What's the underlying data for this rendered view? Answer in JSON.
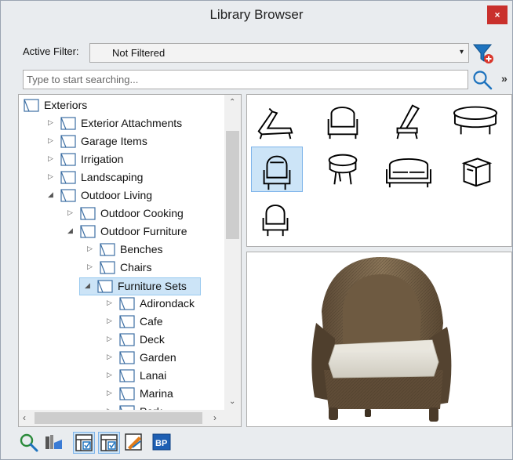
{
  "window": {
    "title": "Library Browser",
    "close_label": "×"
  },
  "filter": {
    "label": "Active Filter:",
    "value": "Not Filtered",
    "arrow": "▾"
  },
  "search": {
    "placeholder": "Type to start searching...",
    "more_label": "»"
  },
  "tree": {
    "items": [
      {
        "label": "Exteriors",
        "level": 0,
        "expander": ""
      },
      {
        "label": "Exterior Attachments",
        "level": 1,
        "expander": "▷"
      },
      {
        "label": "Garage Items",
        "level": 1,
        "expander": "▷"
      },
      {
        "label": "Irrigation",
        "level": 1,
        "expander": "▷"
      },
      {
        "label": "Landscaping",
        "level": 1,
        "expander": "▷"
      },
      {
        "label": "Outdoor Living",
        "level": 1,
        "expander": "◢"
      },
      {
        "label": "Outdoor Cooking",
        "level": 2,
        "expander": "▷"
      },
      {
        "label": "Outdoor Furniture",
        "level": 2,
        "expander": "◢"
      },
      {
        "label": "Benches",
        "level": 3,
        "expander": "▷"
      },
      {
        "label": "Chairs",
        "level": 3,
        "expander": "▷"
      },
      {
        "label": "Furniture Sets",
        "level": 3,
        "expander": "◢",
        "selected": true
      },
      {
        "label": "Adirondack",
        "level": 4,
        "expander": "▷"
      },
      {
        "label": "Cafe",
        "level": 4,
        "expander": "▷"
      },
      {
        "label": "Deck",
        "level": 4,
        "expander": "▷"
      },
      {
        "label": "Garden",
        "level": 4,
        "expander": "▷"
      },
      {
        "label": "Lanai",
        "level": 4,
        "expander": "▷"
      },
      {
        "label": "Marina",
        "level": 4,
        "expander": "▷"
      },
      {
        "label": "Park",
        "level": 4,
        "expander": "▷"
      }
    ]
  },
  "thumbnails": [
    {
      "icon": "chaise-lounge-icon"
    },
    {
      "icon": "wicker-armchair-icon"
    },
    {
      "icon": "lounge-chair-icon"
    },
    {
      "icon": "coffee-table-icon"
    },
    {
      "icon": "wicker-chair-icon",
      "selected": true
    },
    {
      "icon": "round-table-icon"
    },
    {
      "icon": "sofa-icon"
    },
    {
      "icon": "side-table-icon"
    },
    {
      "icon": "wicker-chair-small-icon"
    }
  ],
  "toolbar": {
    "buttons": [
      {
        "icon": "zoom-refresh-icon",
        "pressed": false
      },
      {
        "icon": "library-objects-icon",
        "pressed": false
      },
      {
        "icon": "filter-view-icon",
        "pressed": true
      },
      {
        "icon": "filter-view-alt-icon",
        "pressed": true
      },
      {
        "icon": "edit-check-icon",
        "pressed": false
      },
      {
        "icon": "bp-icon",
        "pressed": false
      }
    ]
  },
  "colors": {
    "selection": "#cce4f7",
    "selection_border": "#7eb4ea",
    "close": "#c9302c",
    "accent_blue": "#1e73be"
  }
}
